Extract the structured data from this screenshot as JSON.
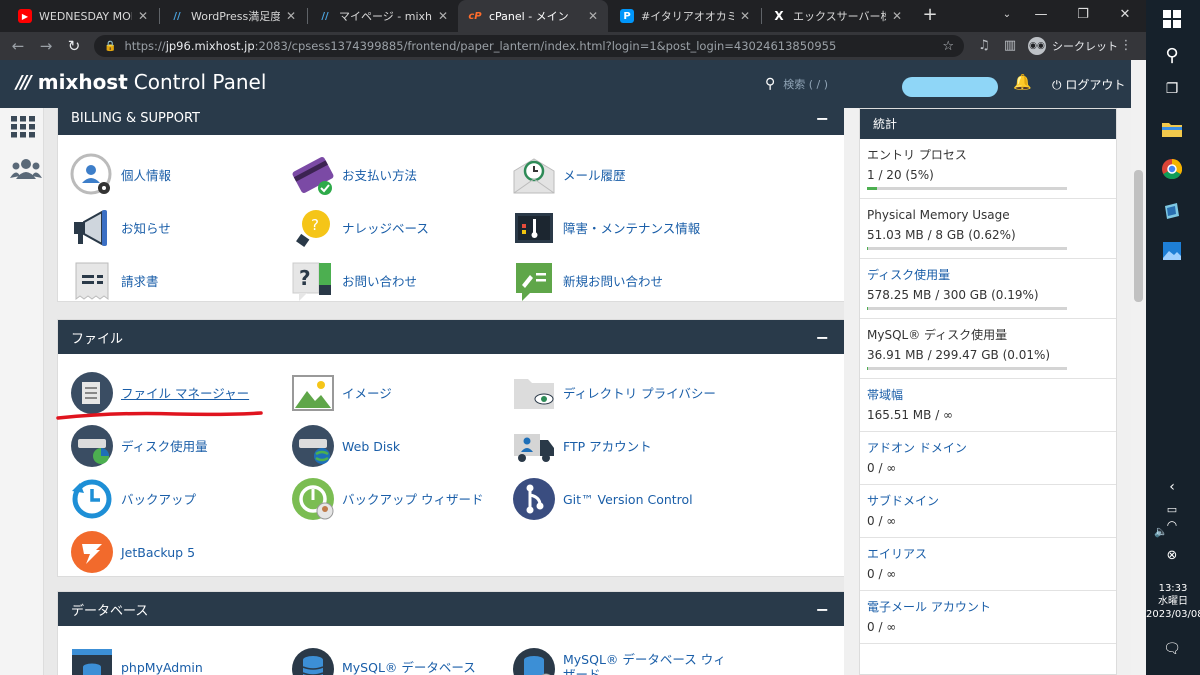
{
  "browser": {
    "tabs": [
      {
        "title": "WEDNESDAY MORN",
        "active": false
      },
      {
        "title": "WordPress満足度No",
        "active": false
      },
      {
        "title": "マイページ - mixhost",
        "active": false
      },
      {
        "title": "cPanel - メイン",
        "active": true
      },
      {
        "title": "#イタリアオオカミけもの",
        "active": false
      },
      {
        "title": "エックスサーバー株式会",
        "active": false
      }
    ],
    "url_scheme": "https://",
    "url_host": "jp96.mixhost.jp",
    "url_rest": ":2083/cpsess1374399885/frontend/paper_lantern/index.html?login=1&post_login=43024613850955",
    "incognito_label": "シークレット"
  },
  "header": {
    "logo_brand": "mixhost",
    "logo_rest": "Control Panel",
    "search_placeholder": "検索 ( / )",
    "logout_label": "ログアウト"
  },
  "groups": {
    "billing": {
      "title": "BILLING & SUPPORT",
      "items": [
        "個人情報",
        "お支払い方法",
        "メール履歴",
        "お知らせ",
        "ナレッジベース",
        "障害・メンテナンス情報",
        "請求書",
        "お問い合わせ",
        "新規お問い合わせ"
      ]
    },
    "files": {
      "title": "ファイル",
      "items": [
        "ファイル マネージャー",
        "イメージ",
        "ディレクトリ プライバシー",
        "ディスク使用量",
        "Web Disk",
        "FTP アカウント",
        "バックアップ",
        "バックアップ ウィザード",
        "Git™ Version Control",
        "JetBackup 5"
      ]
    },
    "databases": {
      "title": "データベース",
      "items": [
        "phpMyAdmin",
        "MySQL® データベース",
        "MySQL® データベース ウィザード"
      ]
    }
  },
  "stats": {
    "title": "統計",
    "items": [
      {
        "name": "エントリ プロセス",
        "value": "1 / 20   (5%)",
        "percent": 5
      },
      {
        "name": "Physical Memory Usage",
        "value": "51.03 MB / 8 GB   (0.62%)",
        "percent": 0.62
      },
      {
        "name": "ディスク使用量",
        "value": "578.25 MB / 300 GB   (0.19%)",
        "percent": 0.19
      },
      {
        "name": "MySQL® ディスク使用量",
        "value": "36.91 MB / 299.47 GB   (0.01%)",
        "percent": 0.01
      },
      {
        "name": "帯域幅",
        "value": "165.51 MB / ∞"
      },
      {
        "name": "アドオン ドメイン",
        "value": "0 / ∞"
      },
      {
        "name": "サブドメイン",
        "value": "0 / ∞"
      },
      {
        "name": "エイリアス",
        "value": "0 / ∞"
      },
      {
        "name": "電子メール アカウント",
        "value": "0 / ∞"
      }
    ]
  },
  "taskbar": {
    "time": "13:33",
    "weekday": "水曜日",
    "date": "2023/03/08"
  },
  "colors": {
    "header_bg": "#293a4a",
    "link": "#1a5ea8",
    "annotation_red": "#e0141e",
    "bar_fill": "#4caf50"
  }
}
